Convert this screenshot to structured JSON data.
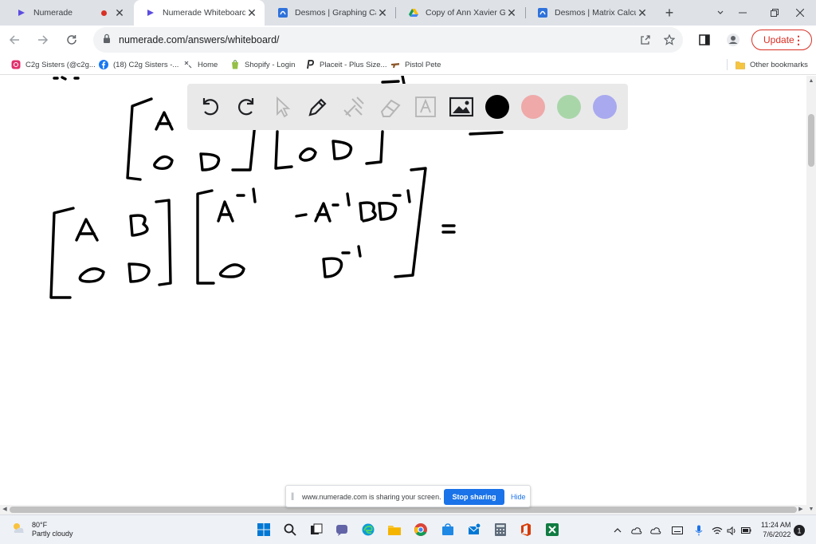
{
  "browser": {
    "tabs": [
      {
        "title": "Numerade",
        "active": false,
        "recording": true,
        "icon": "numerade-icon"
      },
      {
        "title": "Numerade Whiteboard",
        "active": true,
        "recording": false,
        "icon": "numerade-icon"
      },
      {
        "title": "Desmos | Graphing Calculat",
        "active": false,
        "recording": false,
        "icon": "desmos-icon"
      },
      {
        "title": "Copy of Ann Xavier Gante",
        "active": false,
        "recording": false,
        "icon": "google-drive-icon"
      },
      {
        "title": "Desmos | Matrix Calculator",
        "active": false,
        "recording": false,
        "icon": "desmos-icon"
      }
    ],
    "url": "numerade.com/answers/whiteboard/",
    "update_label": "Update",
    "bookmarks": [
      {
        "label": "C2g Sisters (@c2g...",
        "icon": "instagram-icon"
      },
      {
        "label": "(18) C2g Sisters -...",
        "icon": "facebook-icon"
      },
      {
        "label": "Home",
        "icon": "placeit-icon"
      },
      {
        "label": "Shopify - Login",
        "icon": "shopify-icon"
      },
      {
        "label": "Placeit - Plus Size...",
        "icon": "placeit-p-icon"
      },
      {
        "label": "Pistol Pete",
        "icon": "pistol-icon"
      }
    ],
    "other_bookmarks": "Other bookmarks"
  },
  "whiteboard": {
    "tools": [
      "undo-icon",
      "redo-icon",
      "pointer-icon",
      "pen-icon",
      "tools-icon",
      "eraser-icon",
      "text-icon",
      "image-icon"
    ],
    "colors": [
      "#000000",
      "#efa9a9",
      "#a9d6a9",
      "#a9a9ef"
    ],
    "selected_color": "#000000"
  },
  "share_bar": {
    "message": "www.numerade.com is sharing your screen.",
    "stop_label": "Stop sharing",
    "hide_label": "Hide"
  },
  "taskbar": {
    "temperature": "80°F",
    "weather": "Partly cloudy",
    "time": "11:24 AM",
    "date": "7/6/2022"
  }
}
